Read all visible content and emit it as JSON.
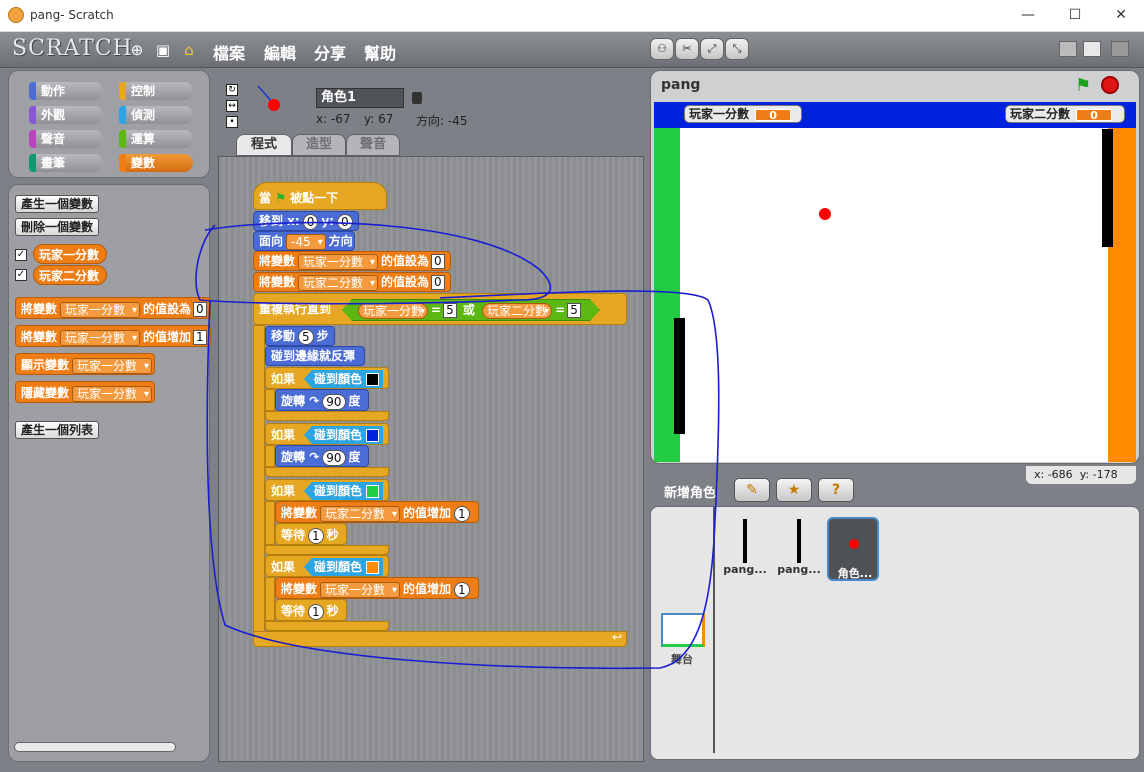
{
  "window": {
    "title": "pang- Scratch",
    "min": "—",
    "max": "☐",
    "close": "✕"
  },
  "menubar": {
    "logo": "SCRATCH",
    "menus": [
      "檔案",
      "編輯",
      "分享",
      "幫助"
    ]
  },
  "categories": [
    {
      "label": "動作",
      "color": "#4a6cd4"
    },
    {
      "label": "控制",
      "color": "#e6a822"
    },
    {
      "label": "外觀",
      "color": "#8a55d7"
    },
    {
      "label": "偵測",
      "color": "#2ca5e2"
    },
    {
      "label": "聲音",
      "color": "#bb42c3"
    },
    {
      "label": "運算",
      "color": "#5cb712"
    },
    {
      "label": "畫筆",
      "color": "#0e9a6c"
    },
    {
      "label": "變數",
      "color": "#ee7d16",
      "selected": true
    }
  ],
  "palette": {
    "make_var": "產生一個變數",
    "delete_var": "刪除一個變數",
    "var1": "玩家一分數",
    "var2": "玩家二分數",
    "set_block": {
      "prefix": "將變數",
      "var": "玩家一分數",
      "suffix": "的值設為",
      "value": "0"
    },
    "change_block": {
      "prefix": "將變數",
      "var": "玩家一分數",
      "suffix": "的值增加",
      "value": "1"
    },
    "show_block": {
      "prefix": "顯示變數",
      "var": "玩家一分數"
    },
    "hide_block": {
      "prefix": "隱藏變數",
      "var": "玩家一分數"
    },
    "make_list": "產生一個列表"
  },
  "sprite": {
    "name": "角色1",
    "x": "x: -67",
    "y": "y: 67",
    "direction": "方向: -45"
  },
  "tabs": [
    "程式",
    "造型",
    "聲音"
  ],
  "script": {
    "hat": {
      "when": "當",
      "clicked": "被點一下"
    },
    "goto": {
      "label": "移到 x:",
      "x": "0",
      "ylabel": "y:",
      "y": "0"
    },
    "point": {
      "label": "面向",
      "value": "-45",
      "suffix": "方向"
    },
    "set1": {
      "prefix": "將變數",
      "var": "玩家一分數",
      "suffix": "的值設為",
      "value": "0"
    },
    "set2": {
      "prefix": "將變數",
      "var": "玩家二分數",
      "suffix": "的值設為",
      "value": "0"
    },
    "repeat": {
      "label": "重複執行直到",
      "left_var": "玩家一分數",
      "eq": "=",
      "left_val": "5",
      "or": "或",
      "right_var": "玩家二分數",
      "right_val": "5"
    },
    "move": {
      "label": "移動",
      "value": "5",
      "suffix": "步"
    },
    "bounce": "碰到邊緣就反彈",
    "if_label": "如果",
    "touch_color": "碰到顏色",
    "turn": {
      "label": "旋轉",
      "value": "90",
      "suffix": "度"
    },
    "change2": {
      "prefix": "將變數",
      "var": "玩家二分數",
      "suffix": "的值增加",
      "value": "1"
    },
    "change1": {
      "prefix": "將變數",
      "var": "玩家一分數",
      "suffix": "的值增加",
      "value": "1"
    },
    "wait": {
      "label": "等待",
      "value": "1",
      "suffix": "秒"
    },
    "colors": [
      "#000000",
      "#0022dd",
      "#22cc44",
      "#ff8c00"
    ]
  },
  "stage": {
    "title": "pang",
    "monitor1": {
      "label": "玩家一分數",
      "value": "0"
    },
    "monitor2": {
      "label": "玩家二分數",
      "value": "0"
    },
    "mouse_x": "x: -686",
    "mouse_y": "y: -178"
  },
  "sprites_panel": {
    "new_sprite": "新增角色",
    "sprites": [
      "pang...",
      "pang...",
      "角色..."
    ],
    "stage_label": "舞台"
  }
}
